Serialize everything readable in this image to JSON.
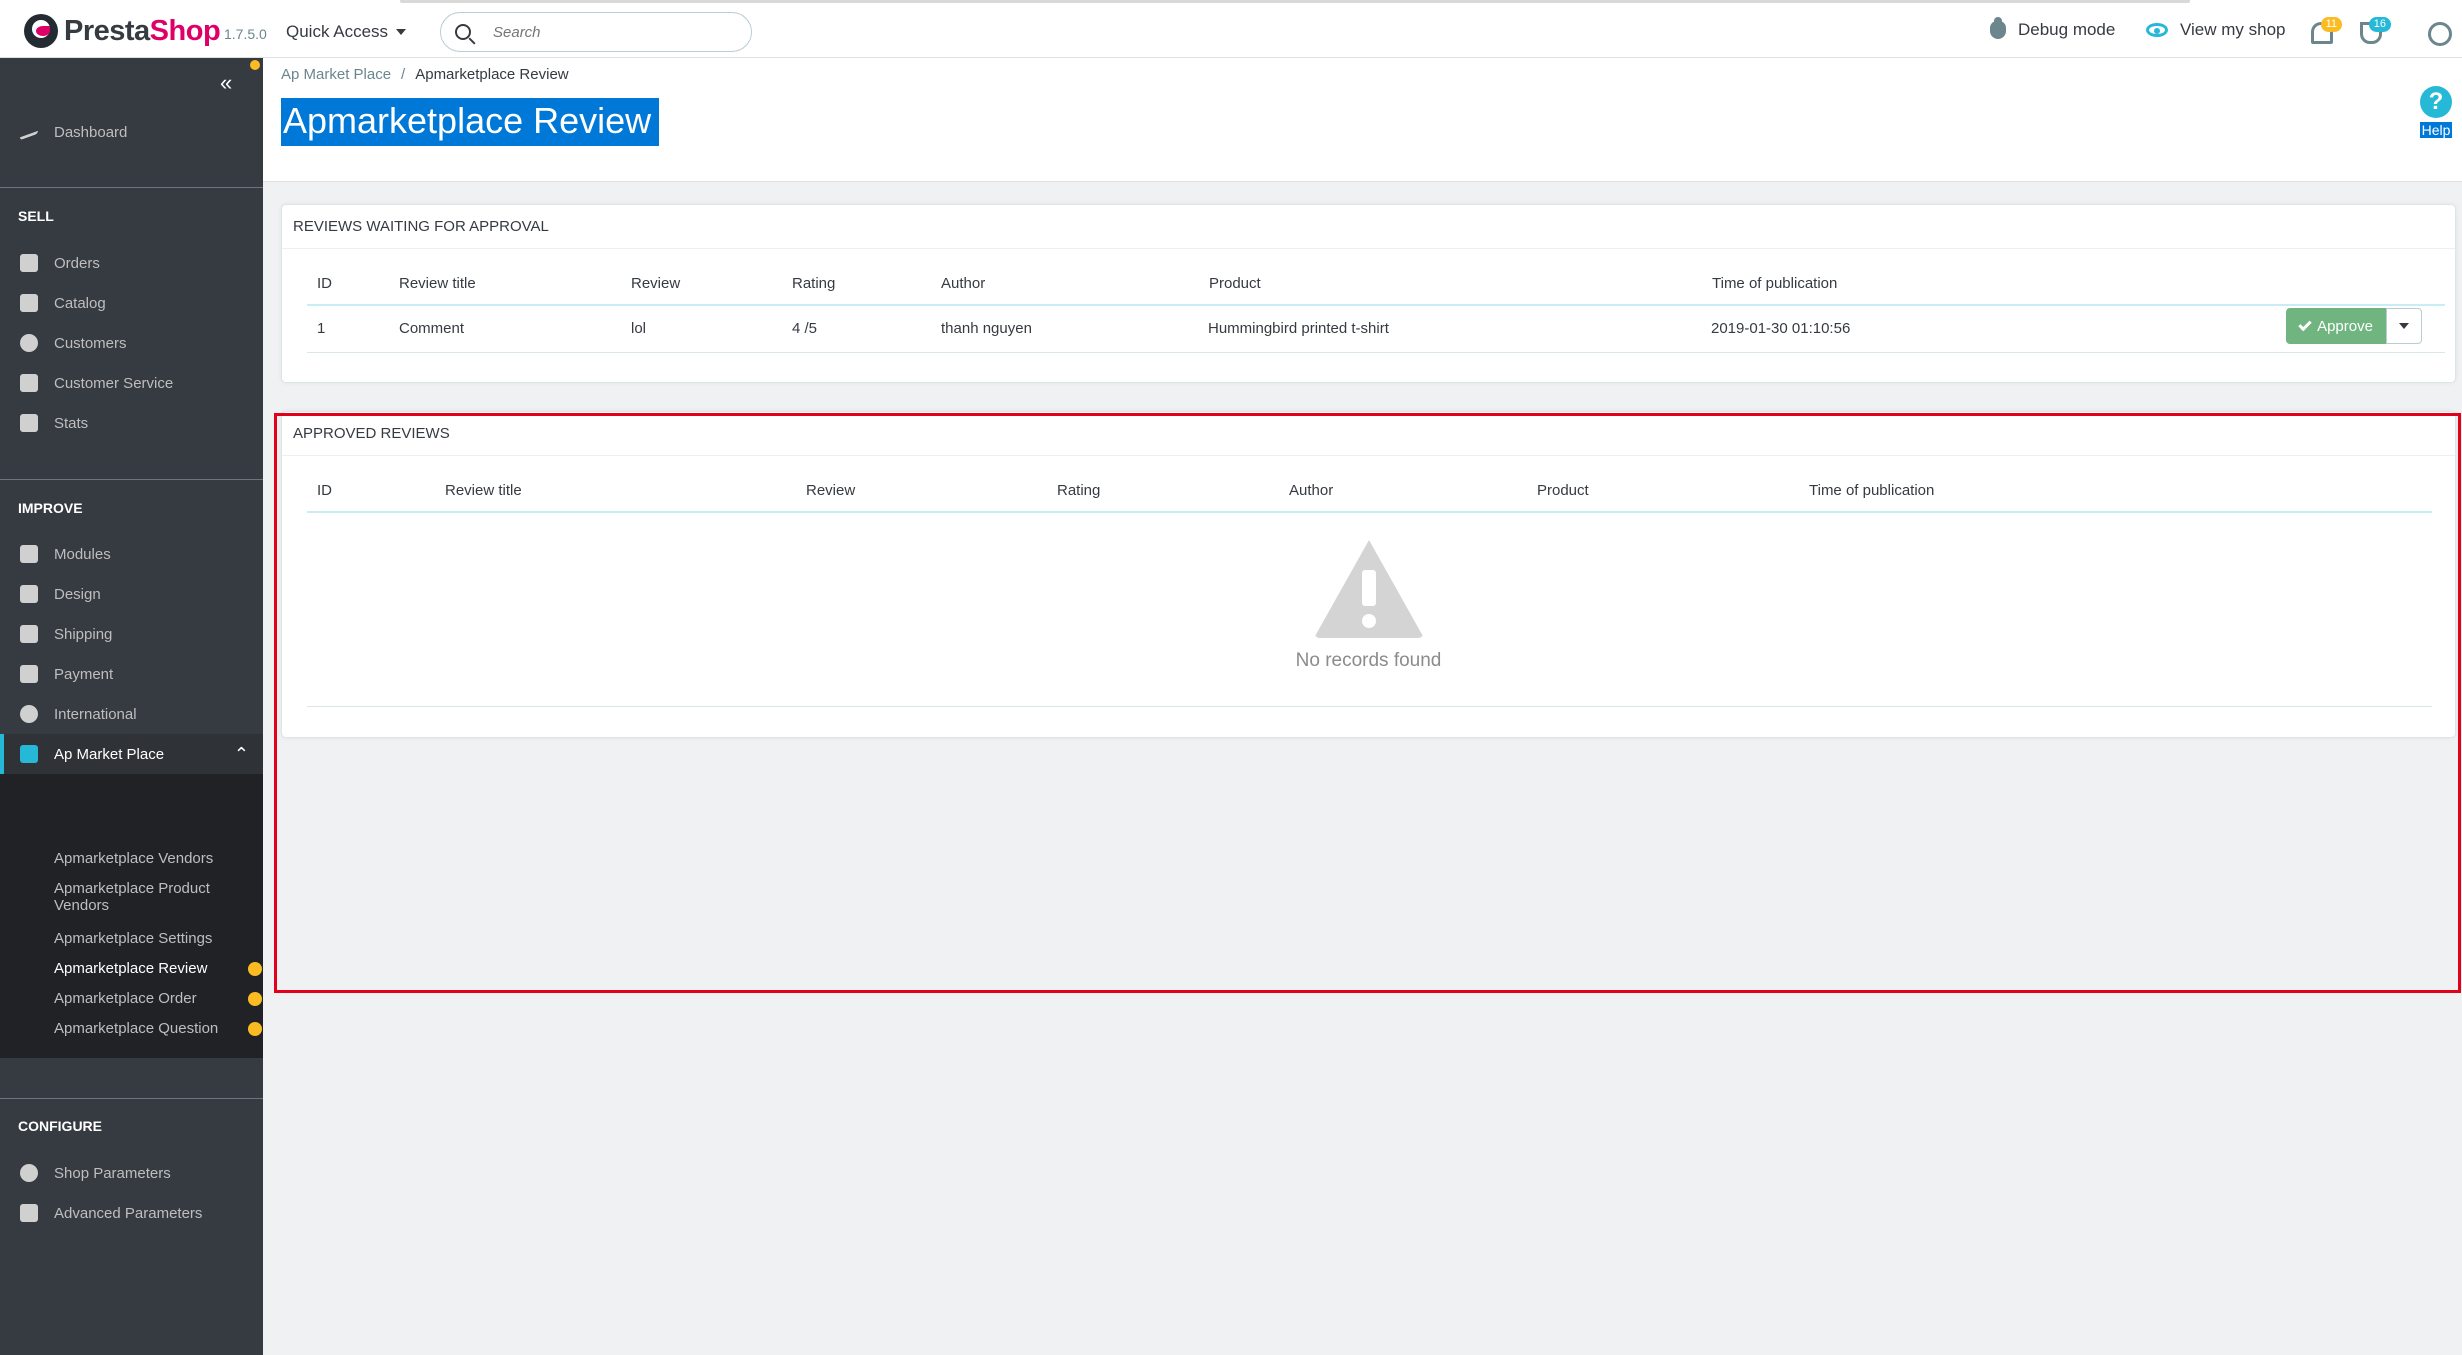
{
  "header": {
    "brand_presta": "Presta",
    "brand_shop": "Shop",
    "version": "1.7.5.0",
    "quick_access": "Quick Access",
    "search_placeholder": "Search",
    "debug_mode": "Debug mode",
    "view_shop": "View my shop",
    "notif_count": "11",
    "orders_count": "16"
  },
  "sidebar": {
    "collapse": "«",
    "dashboard": "Dashboard",
    "sections": {
      "sell": "SELL",
      "improve": "IMPROVE",
      "configure": "CONFIGURE"
    },
    "sell_items": [
      "Orders",
      "Catalog",
      "Customers",
      "Customer Service",
      "Stats"
    ],
    "improve_items": [
      "Modules",
      "Design",
      "Shipping",
      "Payment",
      "International"
    ],
    "active_item": "Ap Market Place",
    "sub_items": [
      "Apmarketplace Vendors",
      "Apmarketplace Product Vendors",
      "Apmarketplace Settings",
      "Apmarketplace Review",
      "Apmarketplace Order",
      "Apmarketplace Question"
    ],
    "configure_items": [
      "Shop Parameters",
      "Advanced Parameters"
    ]
  },
  "toolbar": {
    "breadcrumb_parent": "Ap Market Place",
    "breadcrumb_sep": "/",
    "breadcrumb_current": "Apmarketplace Review",
    "title": "Apmarketplace Review",
    "help": "Help"
  },
  "waiting_panel": {
    "title": "REVIEWS WAITING FOR APPROVAL",
    "columns": [
      "ID",
      "Review title",
      "Review",
      "Rating",
      "Author",
      "Product",
      "Time of publication"
    ],
    "rows": [
      {
        "id": "1",
        "title": "Comment",
        "review": "lol",
        "rating": "4 /5",
        "author": "thanh nguyen",
        "product": "Hummingbird printed t-shirt",
        "time": "2019-01-30 01:10:56"
      }
    ],
    "approve_label": "Approve"
  },
  "approved_panel": {
    "title": "APPROVED REVIEWS",
    "columns": [
      "ID",
      "Review title",
      "Review",
      "Rating",
      "Author",
      "Product",
      "Time of publication"
    ],
    "empty_text": "No records found"
  },
  "colors": {
    "accent": "#25b9d7",
    "brand_pink": "#df0067",
    "sidebar_bg": "#363a41",
    "approve_green": "#70b580",
    "highlight_red": "#e3001b",
    "badge_orange": "#fbbb22"
  }
}
